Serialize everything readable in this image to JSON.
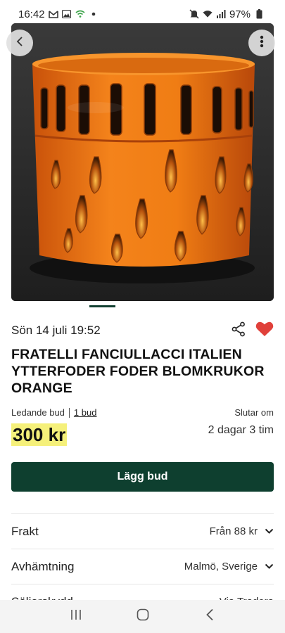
{
  "status_bar": {
    "time": "16:42",
    "battery": "97%",
    "left_icons": [
      "gmail-icon",
      "gallery-icon",
      "wifi-calling-icon",
      "dot-icon"
    ],
    "right_icons": [
      "mute-icon",
      "wifi-icon",
      "signal-icon",
      "battery-icon"
    ]
  },
  "listing": {
    "date": "Sön 14 juli 19:52",
    "title": "FRATELLI FANCIULLACCI ITALIEN YTTERFODER FODER BLOMKRUKOR ORANGE",
    "favorited": true,
    "image_index": 1,
    "image_count": 1
  },
  "bidding": {
    "leading_label": "Ledande bud",
    "bid_count": "1 bud",
    "ends_label": "Slutar om",
    "price": "300 kr",
    "time_left": "2 dagar 3 tim",
    "place_bid_label": "Lägg bud"
  },
  "info": {
    "shipping_label": "Frakt",
    "shipping_value": "Från 88 kr",
    "pickup_label": "Avhämtning",
    "pickup_value": "Malmö, Sverige",
    "partial_label": "Säljarskydd",
    "partial_value": "Via Tradera"
  },
  "colors": {
    "primary": "#0e3f2f",
    "price_highlight": "#f5f07a",
    "heart": "#e0403a",
    "ceramic_orange": "#ef7a12"
  }
}
